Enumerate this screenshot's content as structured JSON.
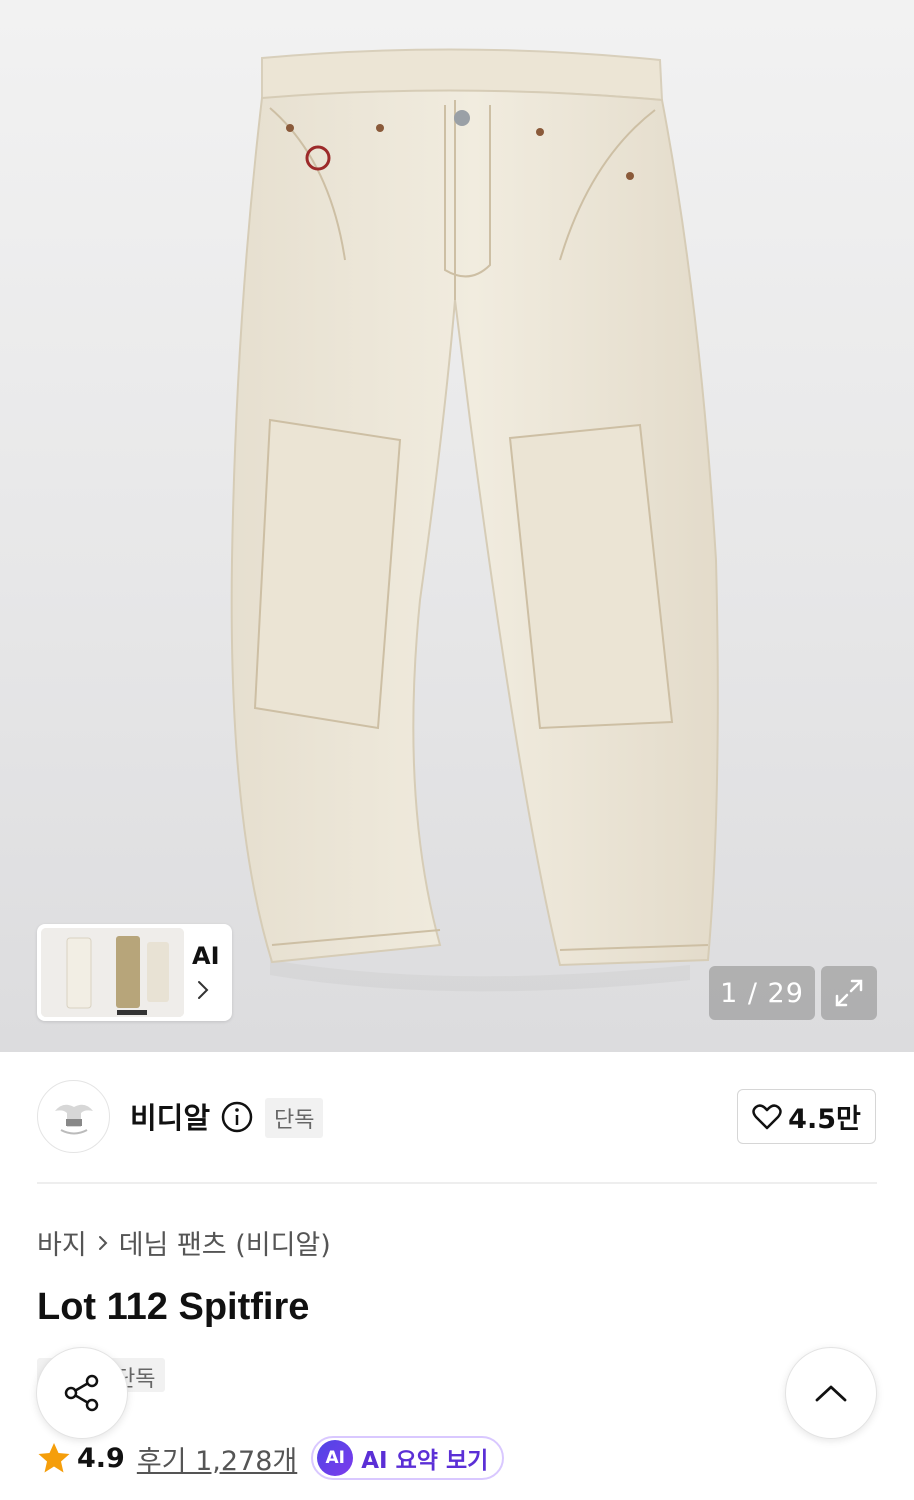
{
  "gallery": {
    "counter": "1 / 29",
    "ai_thumb_label": "AI",
    "icons": [
      "chevron-right-icon",
      "expand-icon"
    ]
  },
  "brand": {
    "name": "비디알",
    "tag": "단독",
    "likes": "4.5만"
  },
  "product": {
    "breadcrumb": {
      "category": "바지",
      "subcategory": "데님 팬츠 (비디알)"
    },
    "title": "Lot 112 Spitfire",
    "exclusive_tag": "단독",
    "rating": "4.9",
    "reviews": "후기 1,278개",
    "ai_summary_badge": "AI",
    "ai_summary": "AI 요약 보기"
  },
  "colors": {
    "accent_purple": "#5b2fd6",
    "star": "#f59e0b"
  }
}
